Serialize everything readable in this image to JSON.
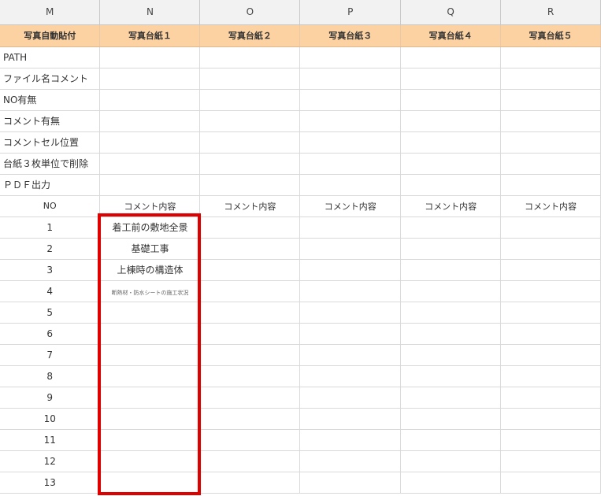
{
  "columns": [
    "M",
    "N",
    "O",
    "P",
    "Q",
    "R"
  ],
  "photo_headers": [
    "写真自動貼付",
    "写真台紙１",
    "写真台紙２",
    "写真台紙３",
    "写真台紙４",
    "写真台紙５"
  ],
  "settings": [
    "PATH",
    "ファイル名コメント",
    "NO有無",
    "コメント有無",
    "コメントセル位置",
    "台紙３枚単位で削除",
    "ＰＤＦ出力"
  ],
  "list_header": {
    "no": "NO",
    "comments": [
      "コメント内容",
      "コメント内容",
      "コメント内容",
      "コメント内容",
      "コメント内容"
    ]
  },
  "rows": [
    {
      "no": "1",
      "comment": "着工前の敷地全景"
    },
    {
      "no": "2",
      "comment": "基礎工事"
    },
    {
      "no": "3",
      "comment": "上棟時の構造体"
    },
    {
      "no": "4",
      "comment": "断熱材・防水シートの施工状況"
    },
    {
      "no": "5",
      "comment": ""
    },
    {
      "no": "6",
      "comment": ""
    },
    {
      "no": "7",
      "comment": ""
    },
    {
      "no": "8",
      "comment": ""
    },
    {
      "no": "9",
      "comment": ""
    },
    {
      "no": "10",
      "comment": ""
    },
    {
      "no": "11",
      "comment": ""
    },
    {
      "no": "12",
      "comment": ""
    },
    {
      "no": "13",
      "comment": ""
    }
  ],
  "highlight_color": "#e00000",
  "header_fill_color": "#fcd2a3"
}
